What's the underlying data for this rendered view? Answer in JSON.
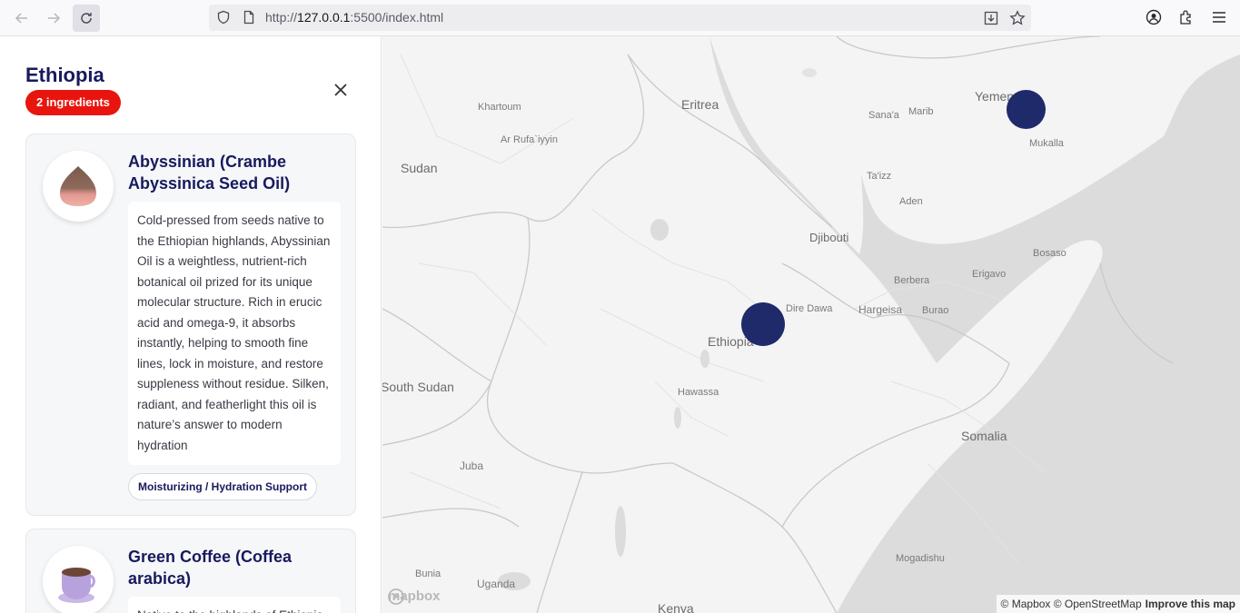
{
  "browser": {
    "url_prefix": "http://",
    "url_host": "127.0.0.1",
    "url_rest": ":5500/index.html"
  },
  "sidebar": {
    "title": "Ethiopia",
    "badge": "2 ingredients",
    "cards": [
      {
        "title": "Abyssinian (Crambe Abyssinica Seed Oil)",
        "description": "Cold-pressed from seeds native to the Ethiopian highlands, Abyssinian Oil is a weightless, nutrient-rich botanical oil prized for its unique molecular structure. Rich in erucic acid and omega-9, it absorbs instantly, helping to smooth fine lines, lock in moisture, and restore suppleness without residue. Silken, radiant, and featherlight this oil is nature’s answer to modern hydration",
        "tag": "Moisturizing / Hydration Support",
        "icon": "oil-drop-icon"
      },
      {
        "title": "Green Coffee (Coffea arabica)",
        "description": "Native to the highlands of Ethiopia, green coffee",
        "icon": "coffee-cup-icon"
      }
    ]
  },
  "map": {
    "labels": {
      "eritrea": "Eritrea",
      "khartoum": "Khartoum",
      "ar_rufa": "Ar Rufa`iyyin",
      "sudan": "Sudan",
      "yemen": "Yemen",
      "sanaa": "Sana'a",
      "marib": "Marib",
      "mukalla": "Mukalla",
      "taizz": "Ta'izz",
      "aden": "Aden",
      "djibouti": "Djibouti",
      "bosaso": "Bosaso",
      "berbera": "Berbera",
      "erigavo": "Erigavo",
      "dire_dawa": "Dire Dawa",
      "hargeisa": "Hargeisa",
      "burao": "Burao",
      "ethiopia": "Ethiopia",
      "hawassa": "Hawassa",
      "south_sudan": "South Sudan",
      "somalia": "Somalia",
      "juba": "Juba",
      "bunia": "Bunia",
      "uganda": "Uganda",
      "mogadishu": "Mogadishu",
      "kenya": "Kenya"
    },
    "logo": "mapbox",
    "attribution": "© Mapbox © OpenStreetMap",
    "improve": "Improve this map",
    "marker_color": "#1f2a6b"
  }
}
